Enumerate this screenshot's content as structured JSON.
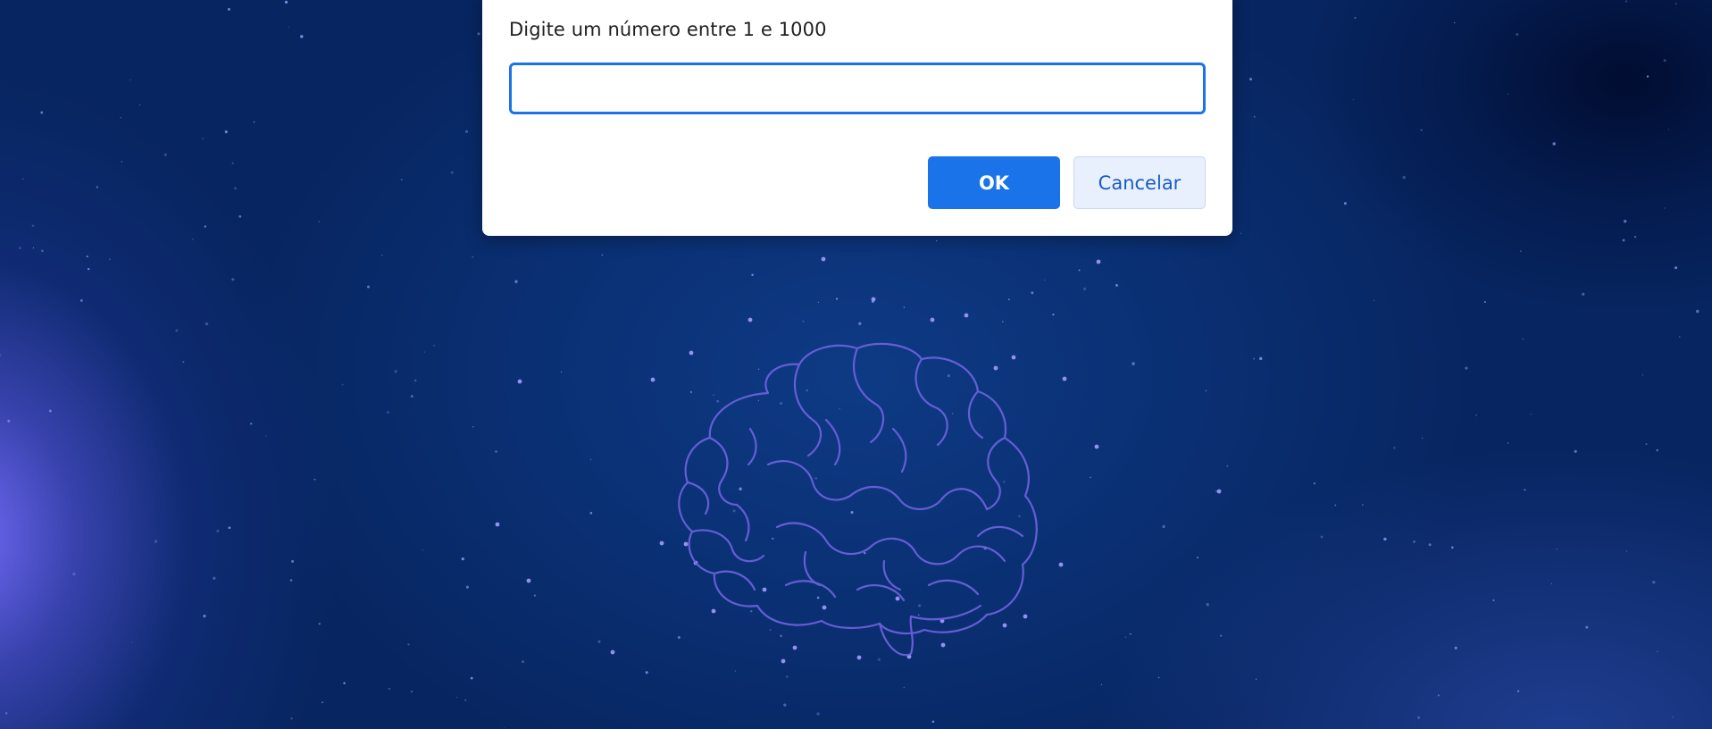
{
  "dialog": {
    "message": "Digite um número entre 1 e 1000",
    "input_value": "",
    "ok_label": "OK",
    "cancel_label": "Cancelar"
  },
  "background": {
    "illustration": "brain-outline",
    "colors": {
      "sky": "#0a2f72",
      "glow": "#7870ff",
      "brain_stroke": "#6f63e0",
      "star": "#8fa6ff"
    }
  },
  "colors": {
    "accent": "#1a73e8",
    "cancel_bg": "#e8f0fe",
    "cancel_text": "#1a5bc4"
  }
}
